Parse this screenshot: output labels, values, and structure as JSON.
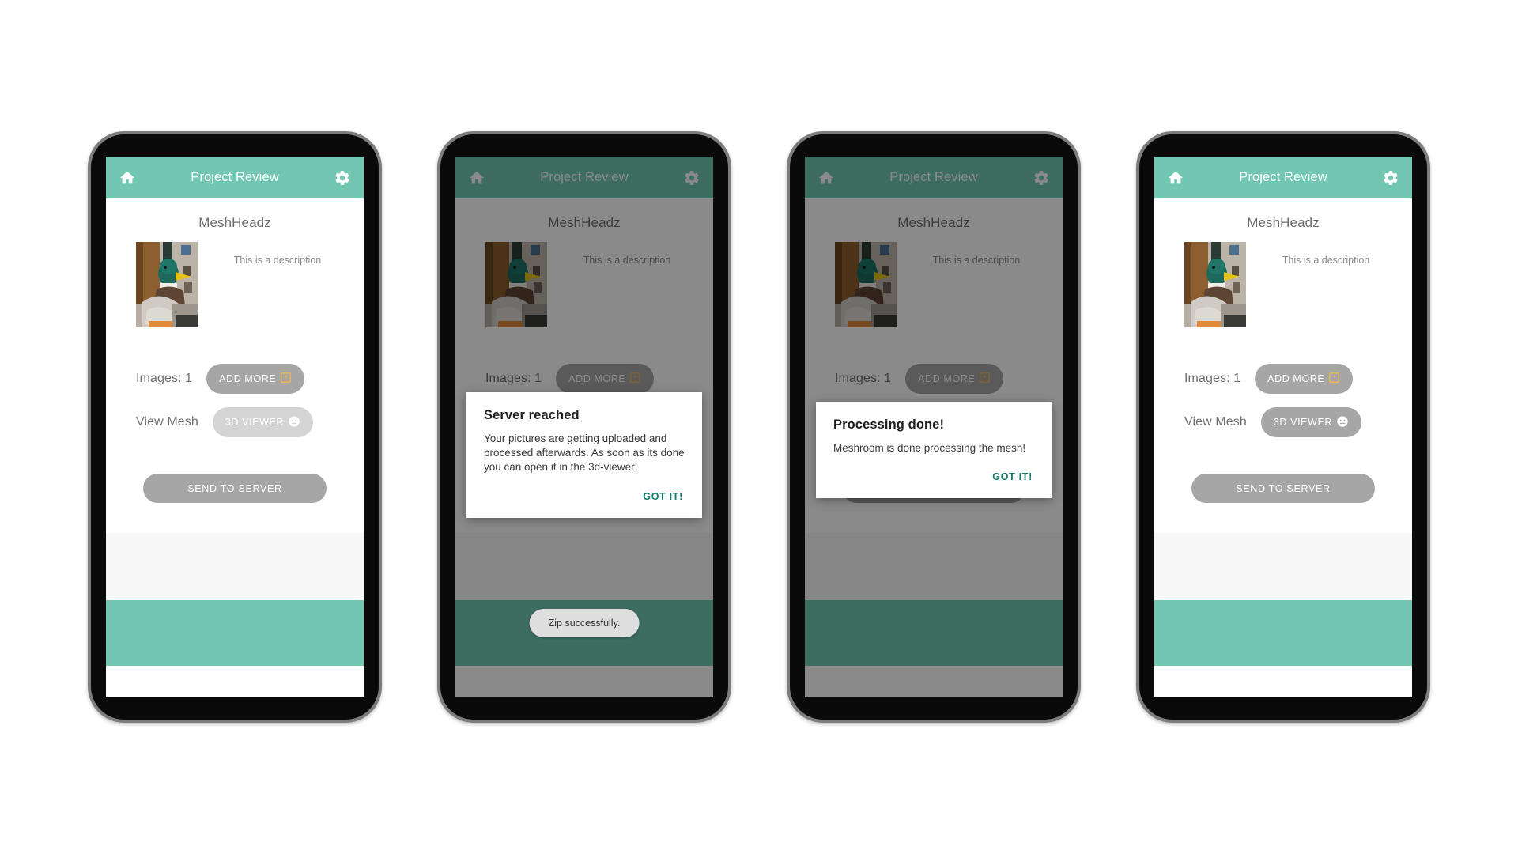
{
  "theme": {
    "accent": "#72c7b2",
    "accent_dim": "#2e5b4e",
    "dialog_action": "#0f7a68",
    "button_enabled": "#a6a6a6",
    "button_disabled": "#d4d4d4",
    "toast_bg": "#dedede",
    "filler_bg": "#f7f7f7"
  },
  "appbar": {
    "title": "Project Review",
    "home_icon": "home-icon",
    "settings_icon": "gear-icon"
  },
  "project": {
    "title": "MeshHeadz",
    "description": "This is a description",
    "thumbnail_alt": "duck-plush-photo"
  },
  "controls": {
    "images_label": "Images: 1",
    "add_more_label": "ADD MORE",
    "add_more_icon": "image-photo-icon",
    "view_mesh_label": "View Mesh",
    "viewer_label": "3D VIEWER",
    "viewer_icon": "face-3d-icon",
    "send_label": "SEND TO SERVER"
  },
  "dialogs": {
    "server_reached": {
      "title": "Server reached",
      "body": "Your pictures are getting uploaded and processed afterwards. As soon as its done you can open it in the 3d-viewer!",
      "action": "GOT IT!"
    },
    "processing_done": {
      "title": "Processing done!",
      "body": "Meshroom is done processing the mesh!",
      "action": "GOT IT!"
    }
  },
  "toast": {
    "zip_success": "Zip successfully."
  },
  "frames": [
    {
      "name": "frame-initial",
      "dimmed": false,
      "viewer_enabled": false,
      "dialog": null,
      "toast": null
    },
    {
      "name": "frame-server-reached",
      "dimmed": true,
      "viewer_enabled": false,
      "dialog": "server_reached",
      "toast": "zip_success"
    },
    {
      "name": "frame-processing-done",
      "dimmed": true,
      "viewer_enabled": false,
      "dialog": "processing_done",
      "toast": null
    },
    {
      "name": "frame-ready",
      "dimmed": false,
      "viewer_enabled": true,
      "dialog": null,
      "toast": null
    }
  ]
}
